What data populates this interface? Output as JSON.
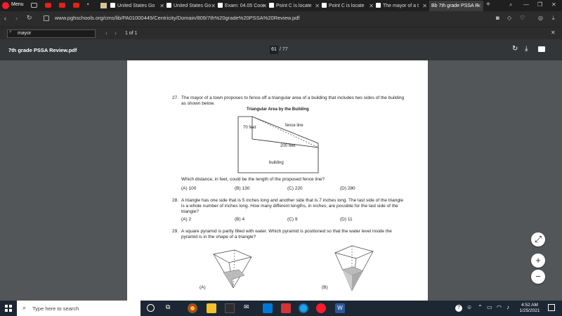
{
  "browser": {
    "menu_label": "Menu",
    "tabs": [
      {
        "label": "United States Go",
        "color": "#ffffff"
      },
      {
        "label": "United States Go",
        "color": "#ffffff"
      },
      {
        "label": "Exam: 04.05 Coor",
        "color": "#ffffff"
      },
      {
        "label": "Point C is locate",
        "color": "#ffffff"
      },
      {
        "label": "Point C is locate",
        "color": "#ffffff"
      },
      {
        "label": "The mayor of a t",
        "color": "#ffffff"
      },
      {
        "label": "Bb 7th grade PSSA R",
        "color": "#ffffff"
      }
    ],
    "new_tab": "+",
    "url": "www.pghschools.org/cms/lib/PA01000449/Centricity/Domain/809/7th%20grade%20PSSA%20Review.pdf",
    "find": {
      "value": "mayor",
      "count": "1 of 1"
    }
  },
  "pdf": {
    "filename": "7th grade PSSA Review.pdf",
    "page_current": "61",
    "page_total": "/ 77"
  },
  "document": {
    "q27": {
      "num": "27.",
      "text": "The mayor of a town proposes to fence off a triangular area of a building that includes two sides of the building as shown below.",
      "figure_title": "Triangular Area by the Building",
      "label_70": "70 feet",
      "label_fence": "fence line",
      "label_200": "200 feet",
      "label_building": "building",
      "question": "Which distance, in feet, could be the length of the proposed fence line?",
      "options": [
        "(A)  100",
        "(B)  130",
        "(C)  220",
        "(D)  280"
      ]
    },
    "q28": {
      "num": "28.",
      "text": "A triangle has one side that is 5 inches long and another side that is 7 inches long. The last side of the triangle is a whole number of inches long. How many different lengths, in inches, are possible for the last side of the triangle?",
      "options": [
        "(A)  2",
        "(B)  4",
        "(C)  9",
        "(D)  11"
      ]
    },
    "q29": {
      "num": "29.",
      "text": "A square pyramid is partly filled with water. Which pyramid is positioned so that the water level inside the pyramid is in the shape of a triangle?",
      "label_a": "(A)",
      "label_b": "(B)"
    }
  },
  "taskbar": {
    "search_placeholder": "Type here to search",
    "time": "4:52 AM",
    "date": "1/25/2021"
  }
}
